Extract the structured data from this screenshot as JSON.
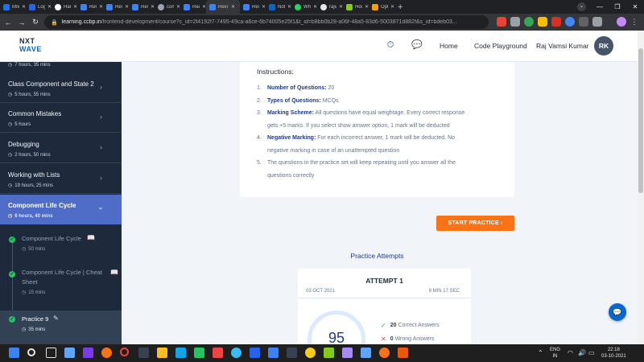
{
  "browser": {
    "tabs": [
      {
        "label": "MIW",
        "color": "#1a73e8"
      },
      {
        "label": "Logi",
        "color": "#2563eb"
      },
      {
        "label": "Harr",
        "color": "#ffffff"
      },
      {
        "label": "Revi",
        "color": "#3b82f6"
      },
      {
        "label": "Revi",
        "color": "#3b82f6"
      },
      {
        "label": "Revi",
        "color": "#3b82f6"
      },
      {
        "label": "com",
        "color": "#9ca3af"
      },
      {
        "label": "Reac",
        "color": "#3b82f6"
      },
      {
        "label": "Revi",
        "color": "#3b82f6"
      },
      {
        "label": "Revi",
        "color": "#3b82f6"
      },
      {
        "label": "Noti",
        "color": "#0a66c2"
      },
      {
        "label": "Wha",
        "color": "#25d366"
      },
      {
        "label": "rajv",
        "color": "#e5e7eb"
      },
      {
        "label": "How",
        "color": "#84cc16"
      },
      {
        "label": "Opti",
        "color": "#f59e0b"
      }
    ],
    "url_domain": "learning.ccbp.in",
    "url_path": "/frontend-development/course?c_id=2f4192f7-7495-49ca-a6ce-6b74005e25f1&t_id=b8bb0b28-a06f-48a5-83d6-5003871d882f&s_id=bdeb03..."
  },
  "header": {
    "logo_line1": "NXT",
    "logo_line2": "WAVE",
    "nav": [
      "Home",
      "Code Playground"
    ],
    "user_name": "Raj Vamsi Kumar",
    "avatar_initials": "RK"
  },
  "sidebar": {
    "top_duration": "7 hours, 35 mins",
    "items": [
      {
        "title": "Class Component and State 2",
        "duration": "5 hours, 55 mins"
      },
      {
        "title": "Common Mistakes",
        "duration": "5 hours"
      },
      {
        "title": "Debugging",
        "duration": "2 hours, 50 mins"
      },
      {
        "title": "Working with Lists",
        "duration": "19 hours, 25 mins"
      },
      {
        "title": "Component Life Cycle",
        "duration": "6 hours, 40 mins"
      }
    ],
    "subitems": [
      {
        "title": "Component Life Cycle",
        "duration": "50 mins"
      },
      {
        "title": "Component Life Cycle | Cheat Sheet",
        "duration": "15 mins"
      },
      {
        "title": "Practice 9",
        "duration": "35 mins"
      }
    ]
  },
  "instructions": {
    "heading": "Instructions:",
    "items": [
      {
        "num": "1.",
        "bold": "Number of Questions:",
        "text": " 20",
        "cont": ""
      },
      {
        "num": "2.",
        "bold": "Types of Questions:",
        "text": " MCQs",
        "cont": ""
      },
      {
        "num": "3.",
        "bold": "Marking Scheme:",
        "text": " All questions have equal weightage. Every correct response",
        "cont": "gets +5 marks. If you select show answer option, 1 mark will be deducted"
      },
      {
        "num": "4.",
        "bold": "Negative Marking:",
        "text": " For each incorrect answer, 1 mark will be deducted. No",
        "cont": "negative marking in case of an unattempted question"
      },
      {
        "num": "5.",
        "bold": "",
        "text": "The questions in the practice set will keep repeating until you answer all the",
        "cont": "questions correctly"
      }
    ]
  },
  "start_button": "START PRACTICE",
  "attempts": {
    "title": "Practice Attempts",
    "attempt_label": "ATTEMPT 1",
    "date": "03 OCT 2021",
    "time": "9 MIN 17 SEC",
    "score": "95",
    "correct_count": "20",
    "correct_label": "Correct Answers",
    "wrong_count": "0",
    "wrong_label": "Wrong Answers"
  },
  "taskbar": {
    "lang1": "ENG",
    "lang2": "IN",
    "time": "22:18",
    "date": "03-10-2021"
  }
}
